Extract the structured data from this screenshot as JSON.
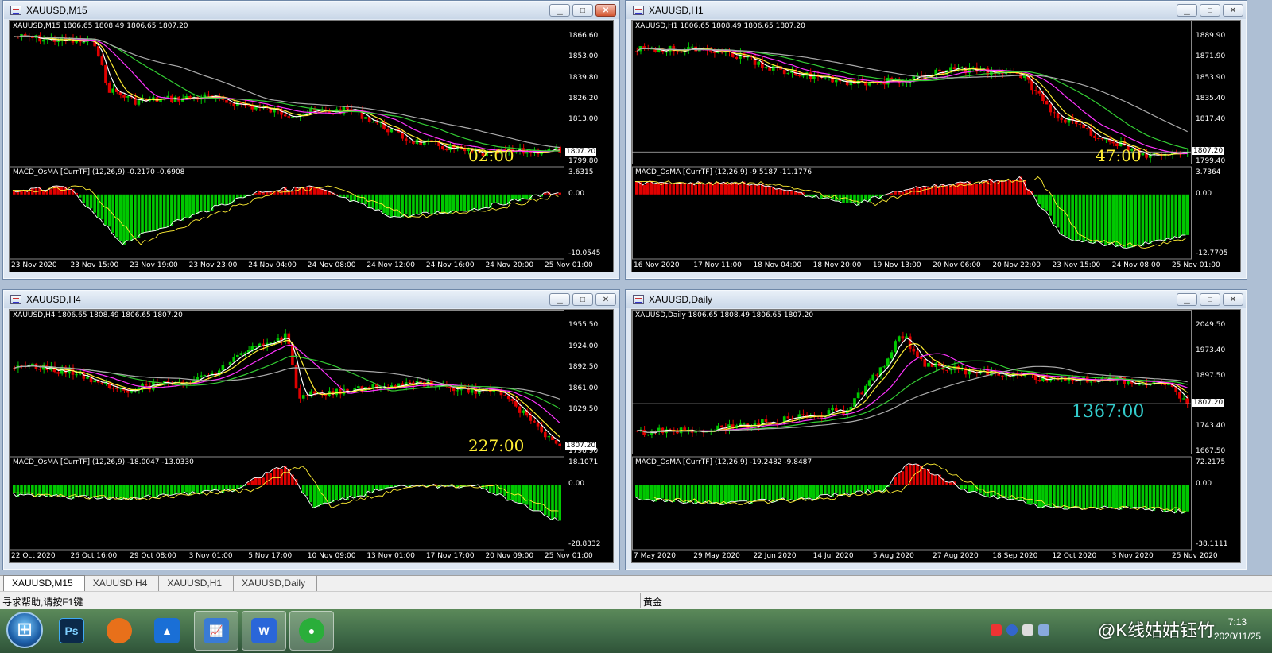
{
  "windows": [
    {
      "title": "XAUUSD,M15",
      "info": "XAUUSD,M15  1806.65 1808.49 1806.65 1807.20",
      "price_labels": [
        "1866.60",
        "1853.00",
        "1839.80",
        "1826.20",
        "1813.00",
        "1807.20",
        "1799.80"
      ],
      "current_price": "1807.20",
      "timer": "02:00",
      "timer_color": "#ffee33",
      "macd_label": "MACD_OsMA [CurrTF] (12,26,9) -0.2170 -0.6908",
      "macd_labels": [
        "3.6315",
        "0.00",
        "-10.0545"
      ],
      "time_labels": [
        "23 Nov 2020",
        "23 Nov 15:00",
        "23 Nov 19:00",
        "23 Nov 23:00",
        "24 Nov 04:00",
        "24 Nov 08:00",
        "24 Nov 12:00",
        "24 Nov 16:00",
        "24 Nov 20:00",
        "25 Nov 01:00"
      ]
    },
    {
      "title": "XAUUSD,H1",
      "info": "XAUUSD,H1  1806.65 1808.49 1806.65 1807.20",
      "price_labels": [
        "1889.90",
        "1871.90",
        "1853.90",
        "1835.40",
        "1817.40",
        "1807.20",
        "1799.40"
      ],
      "current_price": "1807.20",
      "timer": "47:00",
      "timer_color": "#ffee33",
      "macd_label": "MACD_OsMA [CurrTF] (12,26,9) -9.5187 -11.1776",
      "macd_labels": [
        "3.7364",
        "0.00",
        "-12.7705"
      ],
      "time_labels": [
        "16 Nov 2020",
        "17 Nov 11:00",
        "18 Nov 04:00",
        "18 Nov 20:00",
        "19 Nov 13:00",
        "20 Nov 06:00",
        "20 Nov 22:00",
        "23 Nov 15:00",
        "24 Nov 08:00",
        "25 Nov 01:00"
      ]
    },
    {
      "title": "XAUUSD,H4",
      "info": "XAUUSD,H4  1806.65 1808.49 1806.65 1807.20",
      "price_labels": [
        "1955.50",
        "1924.00",
        "1892.50",
        "1861.00",
        "1829.50",
        "1807.20",
        "1798.90"
      ],
      "current_price": "1807.20",
      "timer": "227:00",
      "timer_color": "#ffee33",
      "macd_label": "MACD_OsMA [CurrTF] (12,26,9) -18.0047 -13.0330",
      "macd_labels": [
        "18.1071",
        "0.00",
        "-28.8332"
      ],
      "time_labels": [
        "22 Oct 2020",
        "26 Oct 16:00",
        "29 Oct 08:00",
        "3 Nov 01:00",
        "5 Nov 17:00",
        "10 Nov 09:00",
        "13 Nov 01:00",
        "17 Nov 17:00",
        "20 Nov 09:00",
        "25 Nov 01:00"
      ]
    },
    {
      "title": "XAUUSD,Daily",
      "info": "XAUUSD,Daily  1806.65 1808.49 1806.65 1807.20",
      "price_labels": [
        "2049.50",
        "1973.40",
        "1897.50",
        "1807.20",
        "1743.40",
        "1667.50"
      ],
      "current_price": "1807.20",
      "timer": "1367:00",
      "timer_color": "#33cccc",
      "macd_label": "MACD_OsMA [CurrTF] (12,26,9) -19.2482 -9.8487",
      "macd_labels": [
        "72.2175",
        "0.00",
        "-38.1111"
      ],
      "time_labels": [
        "7 May 2020",
        "29 May 2020",
        "22 Jun 2020",
        "14 Jul 2020",
        "5 Aug 2020",
        "27 Aug 2020",
        "18 Sep 2020",
        "12 Oct 2020",
        "3 Nov 2020",
        "25 Nov 2020"
      ]
    }
  ],
  "tabs": [
    "XAUUSD,M15",
    "XAUUSD,H4",
    "XAUUSD,H1",
    "XAUUSD,Daily"
  ],
  "status": {
    "help": "寻求帮助,请按F1键",
    "symbol": "黄金"
  },
  "taskbar": {
    "apps": [
      {
        "name": "photoshop",
        "label": "Ps",
        "color": "#0b2a4a"
      },
      {
        "name": "app-orange",
        "label": "",
        "color": "#e8701a"
      },
      {
        "name": "app-blue",
        "label": "",
        "color": "#1a6fd6"
      },
      {
        "name": "metatrader",
        "label": "",
        "color": "#3a7bd5"
      },
      {
        "name": "wps",
        "label": "W",
        "color": "#2a66d9"
      },
      {
        "name": "wechat",
        "label": "",
        "color": "#2aae3a"
      }
    ],
    "watermark": "@K线姑姑钰竹",
    "time": "7:13",
    "date": "2020/11/25"
  },
  "colors": {
    "bull": "#00c800",
    "bear": "#e00000",
    "ma_white": "#ffffff",
    "ma_yellow": "#ffee33",
    "ma_magenta": "#ff33ff",
    "ma_green": "#33cc33",
    "ma_gray": "#aaaaaa"
  }
}
